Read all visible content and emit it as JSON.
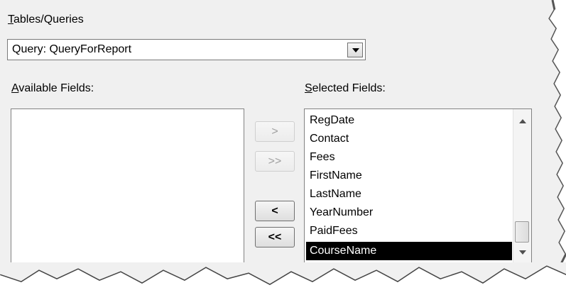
{
  "tables_queries": {
    "label_accel": "T",
    "label_rest": "ables/Queries",
    "selected_value": "Query: QueryForReport"
  },
  "available": {
    "label_accel": "A",
    "label_rest": "vailable Fields:",
    "items": []
  },
  "selected": {
    "label_accel": "S",
    "label_rest": "elected Fields:",
    "items": [
      "RegDate",
      "Contact",
      "Fees",
      "FirstName",
      "LastName",
      "YearNumber",
      "PaidFees",
      "CourseName"
    ],
    "highlighted": "CourseName"
  },
  "buttons": {
    "add_one": ">",
    "add_all": ">>",
    "remove_one": "<",
    "remove_all": "<<"
  },
  "colors": {
    "panel_bg": "#f0f0f0",
    "selection_bg": "#000000",
    "selection_fg": "#ffffff"
  },
  "icons": {
    "combo_arrow": "chevron-down-icon",
    "scroll_up": "scroll-up-icon",
    "scroll_down": "scroll-down-icon"
  }
}
